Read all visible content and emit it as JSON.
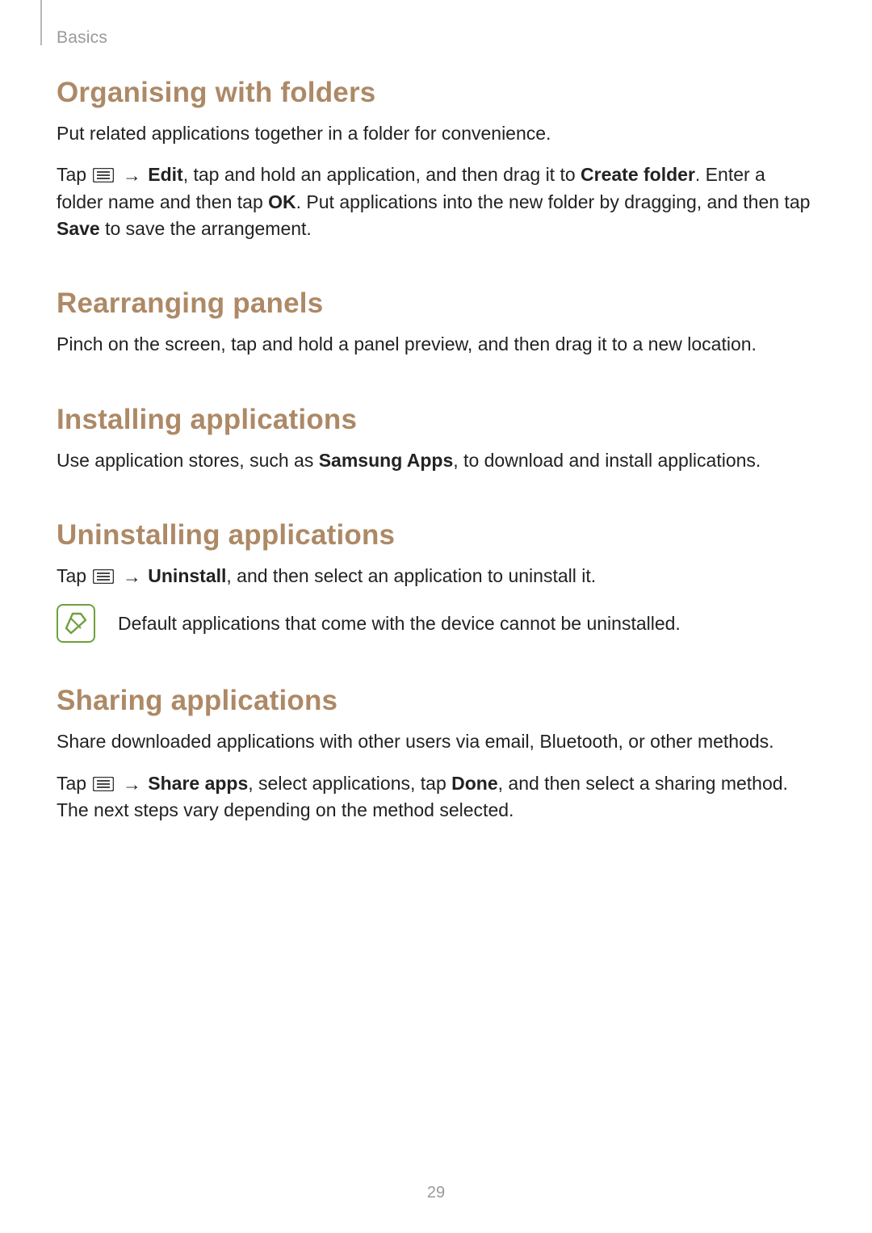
{
  "header": {
    "breadcrumb": "Basics"
  },
  "sections": {
    "organising": {
      "title": "Organising with folders",
      "p1": "Put related applications together in a folder for convenience.",
      "p2_prefix": "Tap ",
      "p2_edit": "Edit",
      "p2_mid1": ", tap and hold an application, and then drag it to ",
      "p2_create": "Create folder",
      "p2_mid2": ". Enter a folder name and then tap ",
      "p2_ok": "OK",
      "p2_mid3": ". Put applications into the new folder by dragging, and then tap ",
      "p2_save": "Save",
      "p2_suffix": " to save the arrangement."
    },
    "rearranging": {
      "title": "Rearranging panels",
      "p1": "Pinch on the screen, tap and hold a panel preview, and then drag it to a new location."
    },
    "installing": {
      "title": "Installing applications",
      "p1_prefix": "Use application stores, such as ",
      "p1_bold": "Samsung Apps",
      "p1_suffix": ", to download and install applications."
    },
    "uninstalling": {
      "title": "Uninstalling applications",
      "p1_prefix": "Tap ",
      "p1_bold": "Uninstall",
      "p1_suffix": ", and then select an application to uninstall it.",
      "note": "Default applications that come with the device cannot be uninstalled."
    },
    "sharing": {
      "title": "Sharing applications",
      "p1": "Share downloaded applications with other users via email, Bluetooth, or other methods.",
      "p2_prefix": "Tap ",
      "p2_share": "Share apps",
      "p2_mid": ", select applications, tap ",
      "p2_done": "Done",
      "p2_suffix": ", and then select a sharing method. The next steps vary depending on the method selected."
    }
  },
  "glyphs": {
    "arrow": "→"
  },
  "page_number": "29"
}
